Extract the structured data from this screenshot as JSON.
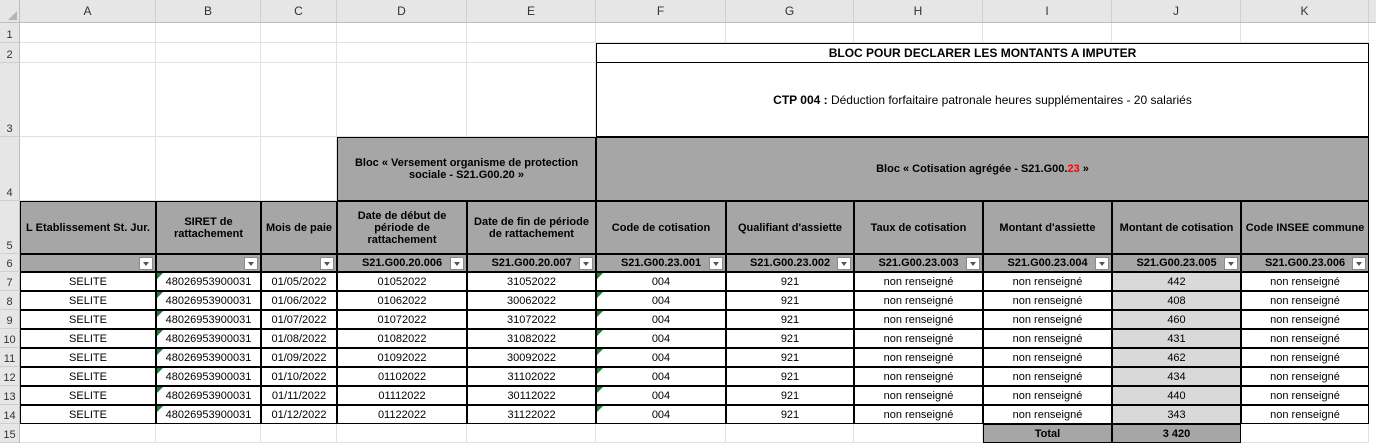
{
  "columns": [
    "A",
    "B",
    "C",
    "D",
    "E",
    "F",
    "G",
    "H",
    "I",
    "J",
    "K"
  ],
  "rows": [
    "1",
    "2",
    "3",
    "4",
    "5",
    "6",
    "7",
    "8",
    "9",
    "10",
    "11",
    "12",
    "13",
    "14",
    "15"
  ],
  "bloc_title": "BLOC POUR DECLARER LES MONTANTS A IMPUTER",
  "ctp": {
    "label": "CTP 004 :",
    "text": " Déduction forfaitaire patronale heures supplémentaires - 20 salariés"
  },
  "bloc_versement": "Bloc « Versement organisme de protection sociale - S21.G00.20 »",
  "bloc_cotisation": {
    "prefix": "Bloc « Cotisation agrégée - S21.G00.",
    "red": "23",
    "suffix": " »"
  },
  "headers": [
    "L Etablissement St. Jur.",
    "SIRET de rattachement",
    "Mois de paie",
    "Date de début de période de rattachement",
    "Date de fin de période de rattachement",
    "Code de cotisation",
    "Qualifiant d'assiette",
    "Taux de cotisation",
    "Montant d'assiette",
    "Montant de cotisation",
    "Code INSEE commune"
  ],
  "codes": [
    "",
    "",
    "",
    "S21.G00.20.006",
    "S21.G00.20.007",
    "S21.G00.23.001",
    "S21.G00.23.002",
    "S21.G00.23.003",
    "S21.G00.23.004",
    "S21.G00.23.005",
    "S21.G00.23.006"
  ],
  "data": [
    [
      "SELITE",
      "48026953900031",
      "01/05/2022",
      "01052022",
      "31052022",
      "004",
      "921",
      "non renseigné",
      "non renseigné",
      "442",
      "non renseigné"
    ],
    [
      "SELITE",
      "48026953900031",
      "01/06/2022",
      "01062022",
      "30062022",
      "004",
      "921",
      "non renseigné",
      "non renseigné",
      "408",
      "non renseigné"
    ],
    [
      "SELITE",
      "48026953900031",
      "01/07/2022",
      "01072022",
      "31072022",
      "004",
      "921",
      "non renseigné",
      "non renseigné",
      "460",
      "non renseigné"
    ],
    [
      "SELITE",
      "48026953900031",
      "01/08/2022",
      "01082022",
      "31082022",
      "004",
      "921",
      "non renseigné",
      "non renseigné",
      "431",
      "non renseigné"
    ],
    [
      "SELITE",
      "48026953900031",
      "01/09/2022",
      "01092022",
      "30092022",
      "004",
      "921",
      "non renseigné",
      "non renseigné",
      "462",
      "non renseigné"
    ],
    [
      "SELITE",
      "48026953900031",
      "01/10/2022",
      "01102022",
      "31102022",
      "004",
      "921",
      "non renseigné",
      "non renseigné",
      "434",
      "non renseigné"
    ],
    [
      "SELITE",
      "48026953900031",
      "01/11/2022",
      "01112022",
      "30112022",
      "004",
      "921",
      "non renseigné",
      "non renseigné",
      "440",
      "non renseigné"
    ],
    [
      "SELITE",
      "48026953900031",
      "01/12/2022",
      "01122022",
      "31122022",
      "004",
      "921",
      "non renseigné",
      "non renseigné",
      "343",
      "non renseigné"
    ]
  ],
  "total": {
    "label": "Total",
    "value": "3 420"
  }
}
